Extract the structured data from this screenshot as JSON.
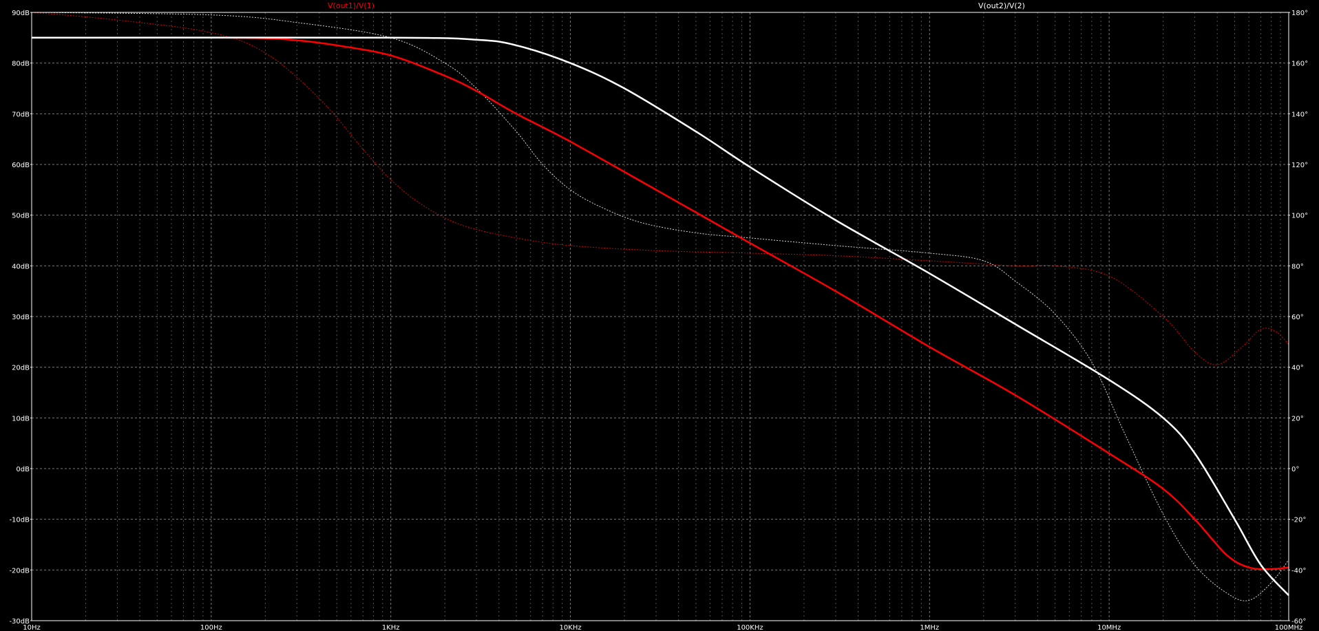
{
  "chart_data": {
    "type": "line",
    "x_scale": "log",
    "xlim": [
      10,
      100000000
    ],
    "ylim_left": [
      -30,
      90
    ],
    "ylim_right": [
      -60,
      180
    ],
    "grid": true,
    "background": "#000000",
    "grid_color": "#8a8a8a",
    "frame_color": "#ffffff",
    "x_tick_labels": [
      {
        "value": 10,
        "label": "10Hz"
      },
      {
        "value": 100,
        "label": "100Hz"
      },
      {
        "value": 1000,
        "label": "1KHz"
      },
      {
        "value": 10000,
        "label": "10KHz"
      },
      {
        "value": 100000,
        "label": "100KHz"
      },
      {
        "value": 1000000,
        "label": "1MHz"
      },
      {
        "value": 10000000,
        "label": "10MHz"
      },
      {
        "value": 100000000,
        "label": "100MHz"
      }
    ],
    "y_tick_labels_left": [
      {
        "value": 90,
        "label": "90dB"
      },
      {
        "value": 80,
        "label": "80dB"
      },
      {
        "value": 70,
        "label": "70dB"
      },
      {
        "value": 60,
        "label": "60dB"
      },
      {
        "value": 50,
        "label": "50dB"
      },
      {
        "value": 40,
        "label": "40dB"
      },
      {
        "value": 30,
        "label": "30dB"
      },
      {
        "value": 20,
        "label": "20dB"
      },
      {
        "value": 10,
        "label": "10dB"
      },
      {
        "value": 0,
        "label": "0dB"
      },
      {
        "value": -10,
        "label": "-10dB"
      },
      {
        "value": -20,
        "label": "-20dB"
      },
      {
        "value": -30,
        "label": "-30dB"
      }
    ],
    "y_tick_labels_right": [
      {
        "value": 180,
        "label": "180°"
      },
      {
        "value": 160,
        "label": "160°"
      },
      {
        "value": 140,
        "label": "140°"
      },
      {
        "value": 120,
        "label": "120°"
      },
      {
        "value": 100,
        "label": "100°"
      },
      {
        "value": 80,
        "label": "80°"
      },
      {
        "value": 60,
        "label": "60°"
      },
      {
        "value": 40,
        "label": "40°"
      },
      {
        "value": 20,
        "label": "20°"
      },
      {
        "value": 0,
        "label": "0°"
      },
      {
        "value": -20,
        "label": "-20°"
      },
      {
        "value": -40,
        "label": "-40°"
      },
      {
        "value": -60,
        "label": "-60°"
      }
    ],
    "legend": [
      {
        "label": "V(out1)/V(1)",
        "color": "#ff0000"
      },
      {
        "label": "V(out2)/V(2)",
        "color": "#ffffff"
      }
    ],
    "series": [
      {
        "name": "V(out1)/V(1)",
        "quantity": "magnitude",
        "axis": "left",
        "color": "#ff0000",
        "style": "solid",
        "points": [
          [
            10,
            85
          ],
          [
            100,
            85
          ],
          [
            200,
            84.9
          ],
          [
            300,
            84.5
          ],
          [
            500,
            83.5
          ],
          [
            1000,
            81.5
          ],
          [
            2000,
            77.5
          ],
          [
            3000,
            74.5
          ],
          [
            5000,
            70
          ],
          [
            10000,
            64.5
          ],
          [
            30000,
            55
          ],
          [
            100000,
            44.5
          ],
          [
            300000,
            35
          ],
          [
            1000000,
            24
          ],
          [
            3000000,
            14.5
          ],
          [
            10000000,
            3
          ],
          [
            20000000,
            -4
          ],
          [
            30000000,
            -10
          ],
          [
            45000000,
            -17
          ],
          [
            60000000,
            -19.5
          ],
          [
            80000000,
            -19.8
          ],
          [
            100000000,
            -19.5
          ]
        ]
      },
      {
        "name": "V(out1)/V(1)",
        "quantity": "phase",
        "axis": "right",
        "color": "#ff0000",
        "style": "dotted",
        "points": [
          [
            10,
            180
          ],
          [
            30,
            177
          ],
          [
            100,
            172
          ],
          [
            200,
            164
          ],
          [
            400,
            146
          ],
          [
            700,
            126
          ],
          [
            1000,
            114
          ],
          [
            1500,
            104
          ],
          [
            2500,
            96
          ],
          [
            5000,
            91
          ],
          [
            10000,
            88
          ],
          [
            30000,
            86
          ],
          [
            100000,
            85
          ],
          [
            300000,
            84
          ],
          [
            1000000,
            82
          ],
          [
            3000000,
            80
          ],
          [
            5000000,
            80
          ],
          [
            10000000,
            76
          ],
          [
            20000000,
            60
          ],
          [
            30000000,
            46
          ],
          [
            40000000,
            41
          ],
          [
            55000000,
            48
          ],
          [
            70000000,
            55
          ],
          [
            85000000,
            54
          ],
          [
            100000000,
            49
          ]
        ]
      },
      {
        "name": "V(out2)/V(2)",
        "quantity": "magnitude",
        "axis": "left",
        "color": "#ffffff",
        "style": "solid",
        "points": [
          [
            10,
            85
          ],
          [
            1000,
            85
          ],
          [
            3000,
            84.6
          ],
          [
            5000,
            83.5
          ],
          [
            10000,
            80
          ],
          [
            20000,
            75
          ],
          [
            50000,
            66.5
          ],
          [
            100000,
            59.5
          ],
          [
            300000,
            49
          ],
          [
            1000000,
            38.5
          ],
          [
            3000000,
            28.5
          ],
          [
            10000000,
            17.5
          ],
          [
            20000000,
            10
          ],
          [
            30000000,
            3
          ],
          [
            50000000,
            -10
          ],
          [
            70000000,
            -19
          ],
          [
            100000000,
            -25
          ]
        ]
      },
      {
        "name": "V(out2)/V(2)",
        "quantity": "phase",
        "axis": "right",
        "color": "#ffffff",
        "style": "dotted",
        "points": [
          [
            10,
            180
          ],
          [
            100,
            179
          ],
          [
            300,
            176
          ],
          [
            1000,
            170
          ],
          [
            2000,
            160
          ],
          [
            3000,
            150
          ],
          [
            5000,
            133
          ],
          [
            7000,
            120
          ],
          [
            10000,
            110
          ],
          [
            15000,
            103
          ],
          [
            25000,
            97
          ],
          [
            50000,
            93
          ],
          [
            100000,
            91
          ],
          [
            300000,
            88
          ],
          [
            1000000,
            85
          ],
          [
            2000000,
            82
          ],
          [
            3000000,
            74
          ],
          [
            5000000,
            61
          ],
          [
            8000000,
            42
          ],
          [
            12000000,
            15
          ],
          [
            20000000,
            -18
          ],
          [
            30000000,
            -38
          ],
          [
            45000000,
            -49
          ],
          [
            60000000,
            -52
          ],
          [
            80000000,
            -45
          ],
          [
            100000000,
            -36
          ]
        ]
      }
    ]
  }
}
